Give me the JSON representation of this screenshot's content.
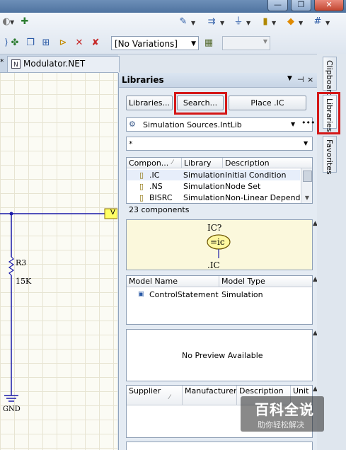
{
  "toolbar": {
    "variation_select": "[No Variations]",
    "icons": [
      "circle-icon",
      "bus-icon",
      "gear-arrow-icon",
      "pencil-icon",
      "grid-icon"
    ]
  },
  "document_tab": {
    "star": "*",
    "label": "Modulator.NET",
    "icon": "net-icon"
  },
  "schematic": {
    "resistor_designator": "R3",
    "resistor_value": "15K",
    "ground_label": "GND",
    "port_label": "V"
  },
  "libraries_panel": {
    "title": "Libraries",
    "header_controls": [
      "▼",
      "⊣",
      "×"
    ],
    "libraries_button": "Libraries...",
    "search_button": "Search...",
    "place_button": "Place .IC",
    "library_select": "Simulation Sources.IntLib",
    "filter_value": "*",
    "component_columns": [
      "Compon...",
      "Library",
      "Description"
    ],
    "components": [
      {
        "name": ".IC",
        "library": "Simulation",
        "description": "Initial Condition"
      },
      {
        "name": ".NS",
        "library": "Simulation",
        "description": "Node Set"
      },
      {
        "name": "BISRC",
        "library": "Simulation",
        "description": "Non-Linear Depende"
      }
    ],
    "component_count": "23 components",
    "preview": {
      "top_label": "IC?",
      "symbol_text": "=ic",
      "bottom_label": ".IC"
    },
    "model_columns": [
      "Model Name",
      "Model Type"
    ],
    "models": [
      {
        "name": "ControlStatement",
        "type": "Simulation"
      }
    ],
    "no_preview": "No Preview Available",
    "supplier_columns": [
      "Supplier",
      "Manufacturer",
      "Description",
      "Unit"
    ]
  },
  "side_tabs": {
    "clipboard": "Clipboard",
    "libraries": "Libraries",
    "favorites": "Favorites"
  },
  "watermark": {
    "title": "百科全说",
    "subtitle": "助你轻松解决"
  },
  "colors": {
    "highlight": "#d41717",
    "preview_bg": "#fbf8dc",
    "wire": "#1a1aa8"
  }
}
